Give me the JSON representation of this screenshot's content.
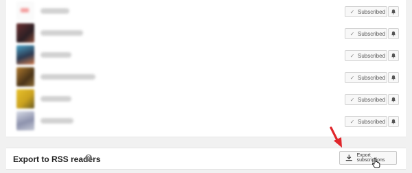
{
  "subscriptions": [
    {
      "button_label": "Subscribed",
      "check_glyph": "✓",
      "thumb_color": "#f7f7f7"
    },
    {
      "button_label": "Subscribed",
      "check_glyph": "✓",
      "thumb_color": "#3b2a2a"
    },
    {
      "button_label": "Subscribed",
      "check_glyph": "✓",
      "thumb_color": "#4c6b7d"
    },
    {
      "button_label": "Subscribed",
      "check_glyph": "✓",
      "thumb_color": "#7a5a2b"
    },
    {
      "button_label": "Subscribed",
      "check_glyph": "✓",
      "thumb_color": "#c8a428"
    },
    {
      "button_label": "Subscribed",
      "check_glyph": "✓",
      "thumb_color": "#9aa0b5"
    }
  ],
  "export": {
    "title": "Export to RSS readers",
    "help_glyph": "?",
    "button_label": "Export subscriptions"
  },
  "colors": {
    "arrow": "#e0262b",
    "page_bg": "#f1f1f1"
  },
  "icons": [
    "checkmark-icon",
    "bell-icon",
    "help-icon",
    "download-icon",
    "red-arrow",
    "hand-cursor"
  ]
}
